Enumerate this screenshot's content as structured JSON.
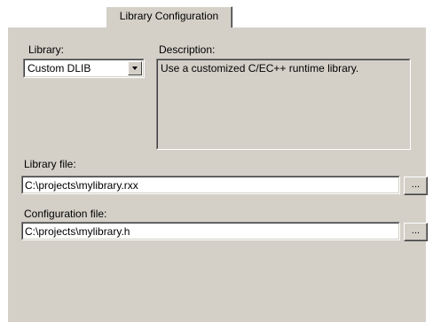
{
  "tab": {
    "label": "Library Configuration"
  },
  "library": {
    "label": "Library:",
    "selected": "Custom DLIB"
  },
  "description": {
    "label": "Description:",
    "text": "Use a customized C/EC++ runtime library."
  },
  "library_file": {
    "label": "Library file:",
    "value": "C:\\projects\\mylibrary.rxx",
    "browse_label": "..."
  },
  "config_file": {
    "label": "Configuration file:",
    "value": "C:\\projects\\mylibrary.h",
    "browse_label": "..."
  },
  "colors": {
    "face": "#d4d0c8",
    "shadow": "#808080",
    "dark_shadow": "#404040",
    "highlight": "#ffffff"
  }
}
